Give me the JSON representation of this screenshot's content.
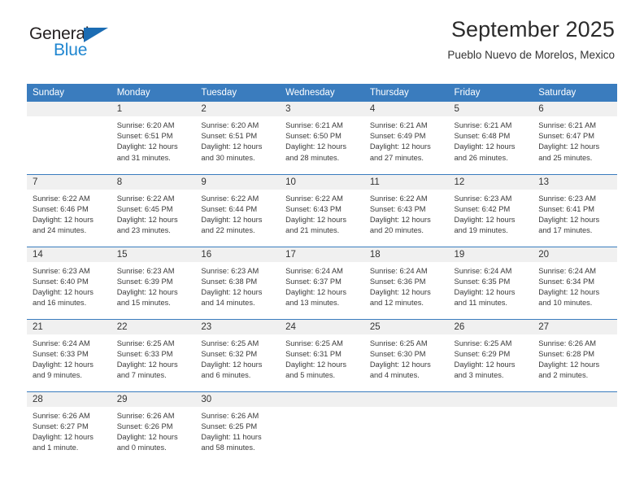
{
  "brand": {
    "name_top": "General",
    "name_bottom": "Blue",
    "triangle_color": "#1b6cb3",
    "blue_color": "#1f86d0",
    "dark_color": "#231f20"
  },
  "header": {
    "title": "September 2025",
    "subtitle": "Pueblo Nuevo de Morelos, Mexico"
  },
  "theme": {
    "header_bg": "#3a7cbe",
    "header_text": "#ffffff",
    "daynum_bg": "#f0f0f0",
    "cell_bg": "#ffffff",
    "body_text": "#3a3a3a"
  },
  "weekdays": [
    "Sunday",
    "Monday",
    "Tuesday",
    "Wednesday",
    "Thursday",
    "Friday",
    "Saturday"
  ],
  "weeks": [
    [
      {
        "day": "",
        "lines": []
      },
      {
        "day": "1",
        "lines": [
          "Sunrise: 6:20 AM",
          "Sunset: 6:51 PM",
          "Daylight: 12 hours",
          "and 31 minutes."
        ]
      },
      {
        "day": "2",
        "lines": [
          "Sunrise: 6:20 AM",
          "Sunset: 6:51 PM",
          "Daylight: 12 hours",
          "and 30 minutes."
        ]
      },
      {
        "day": "3",
        "lines": [
          "Sunrise: 6:21 AM",
          "Sunset: 6:50 PM",
          "Daylight: 12 hours",
          "and 28 minutes."
        ]
      },
      {
        "day": "4",
        "lines": [
          "Sunrise: 6:21 AM",
          "Sunset: 6:49 PM",
          "Daylight: 12 hours",
          "and 27 minutes."
        ]
      },
      {
        "day": "5",
        "lines": [
          "Sunrise: 6:21 AM",
          "Sunset: 6:48 PM",
          "Daylight: 12 hours",
          "and 26 minutes."
        ]
      },
      {
        "day": "6",
        "lines": [
          "Sunrise: 6:21 AM",
          "Sunset: 6:47 PM",
          "Daylight: 12 hours",
          "and 25 minutes."
        ]
      }
    ],
    [
      {
        "day": "7",
        "lines": [
          "Sunrise: 6:22 AM",
          "Sunset: 6:46 PM",
          "Daylight: 12 hours",
          "and 24 minutes."
        ]
      },
      {
        "day": "8",
        "lines": [
          "Sunrise: 6:22 AM",
          "Sunset: 6:45 PM",
          "Daylight: 12 hours",
          "and 23 minutes."
        ]
      },
      {
        "day": "9",
        "lines": [
          "Sunrise: 6:22 AM",
          "Sunset: 6:44 PM",
          "Daylight: 12 hours",
          "and 22 minutes."
        ]
      },
      {
        "day": "10",
        "lines": [
          "Sunrise: 6:22 AM",
          "Sunset: 6:43 PM",
          "Daylight: 12 hours",
          "and 21 minutes."
        ]
      },
      {
        "day": "11",
        "lines": [
          "Sunrise: 6:22 AM",
          "Sunset: 6:43 PM",
          "Daylight: 12 hours",
          "and 20 minutes."
        ]
      },
      {
        "day": "12",
        "lines": [
          "Sunrise: 6:23 AM",
          "Sunset: 6:42 PM",
          "Daylight: 12 hours",
          "and 19 minutes."
        ]
      },
      {
        "day": "13",
        "lines": [
          "Sunrise: 6:23 AM",
          "Sunset: 6:41 PM",
          "Daylight: 12 hours",
          "and 17 minutes."
        ]
      }
    ],
    [
      {
        "day": "14",
        "lines": [
          "Sunrise: 6:23 AM",
          "Sunset: 6:40 PM",
          "Daylight: 12 hours",
          "and 16 minutes."
        ]
      },
      {
        "day": "15",
        "lines": [
          "Sunrise: 6:23 AM",
          "Sunset: 6:39 PM",
          "Daylight: 12 hours",
          "and 15 minutes."
        ]
      },
      {
        "day": "16",
        "lines": [
          "Sunrise: 6:23 AM",
          "Sunset: 6:38 PM",
          "Daylight: 12 hours",
          "and 14 minutes."
        ]
      },
      {
        "day": "17",
        "lines": [
          "Sunrise: 6:24 AM",
          "Sunset: 6:37 PM",
          "Daylight: 12 hours",
          "and 13 minutes."
        ]
      },
      {
        "day": "18",
        "lines": [
          "Sunrise: 6:24 AM",
          "Sunset: 6:36 PM",
          "Daylight: 12 hours",
          "and 12 minutes."
        ]
      },
      {
        "day": "19",
        "lines": [
          "Sunrise: 6:24 AM",
          "Sunset: 6:35 PM",
          "Daylight: 12 hours",
          "and 11 minutes."
        ]
      },
      {
        "day": "20",
        "lines": [
          "Sunrise: 6:24 AM",
          "Sunset: 6:34 PM",
          "Daylight: 12 hours",
          "and 10 minutes."
        ]
      }
    ],
    [
      {
        "day": "21",
        "lines": [
          "Sunrise: 6:24 AM",
          "Sunset: 6:33 PM",
          "Daylight: 12 hours",
          "and 9 minutes."
        ]
      },
      {
        "day": "22",
        "lines": [
          "Sunrise: 6:25 AM",
          "Sunset: 6:33 PM",
          "Daylight: 12 hours",
          "and 7 minutes."
        ]
      },
      {
        "day": "23",
        "lines": [
          "Sunrise: 6:25 AM",
          "Sunset: 6:32 PM",
          "Daylight: 12 hours",
          "and 6 minutes."
        ]
      },
      {
        "day": "24",
        "lines": [
          "Sunrise: 6:25 AM",
          "Sunset: 6:31 PM",
          "Daylight: 12 hours",
          "and 5 minutes."
        ]
      },
      {
        "day": "25",
        "lines": [
          "Sunrise: 6:25 AM",
          "Sunset: 6:30 PM",
          "Daylight: 12 hours",
          "and 4 minutes."
        ]
      },
      {
        "day": "26",
        "lines": [
          "Sunrise: 6:25 AM",
          "Sunset: 6:29 PM",
          "Daylight: 12 hours",
          "and 3 minutes."
        ]
      },
      {
        "day": "27",
        "lines": [
          "Sunrise: 6:26 AM",
          "Sunset: 6:28 PM",
          "Daylight: 12 hours",
          "and 2 minutes."
        ]
      }
    ],
    [
      {
        "day": "28",
        "lines": [
          "Sunrise: 6:26 AM",
          "Sunset: 6:27 PM",
          "Daylight: 12 hours",
          "and 1 minute."
        ]
      },
      {
        "day": "29",
        "lines": [
          "Sunrise: 6:26 AM",
          "Sunset: 6:26 PM",
          "Daylight: 12 hours",
          "and 0 minutes."
        ]
      },
      {
        "day": "30",
        "lines": [
          "Sunrise: 6:26 AM",
          "Sunset: 6:25 PM",
          "Daylight: 11 hours",
          "and 58 minutes."
        ]
      },
      {
        "day": "",
        "lines": []
      },
      {
        "day": "",
        "lines": []
      },
      {
        "day": "",
        "lines": []
      },
      {
        "day": "",
        "lines": []
      }
    ]
  ]
}
